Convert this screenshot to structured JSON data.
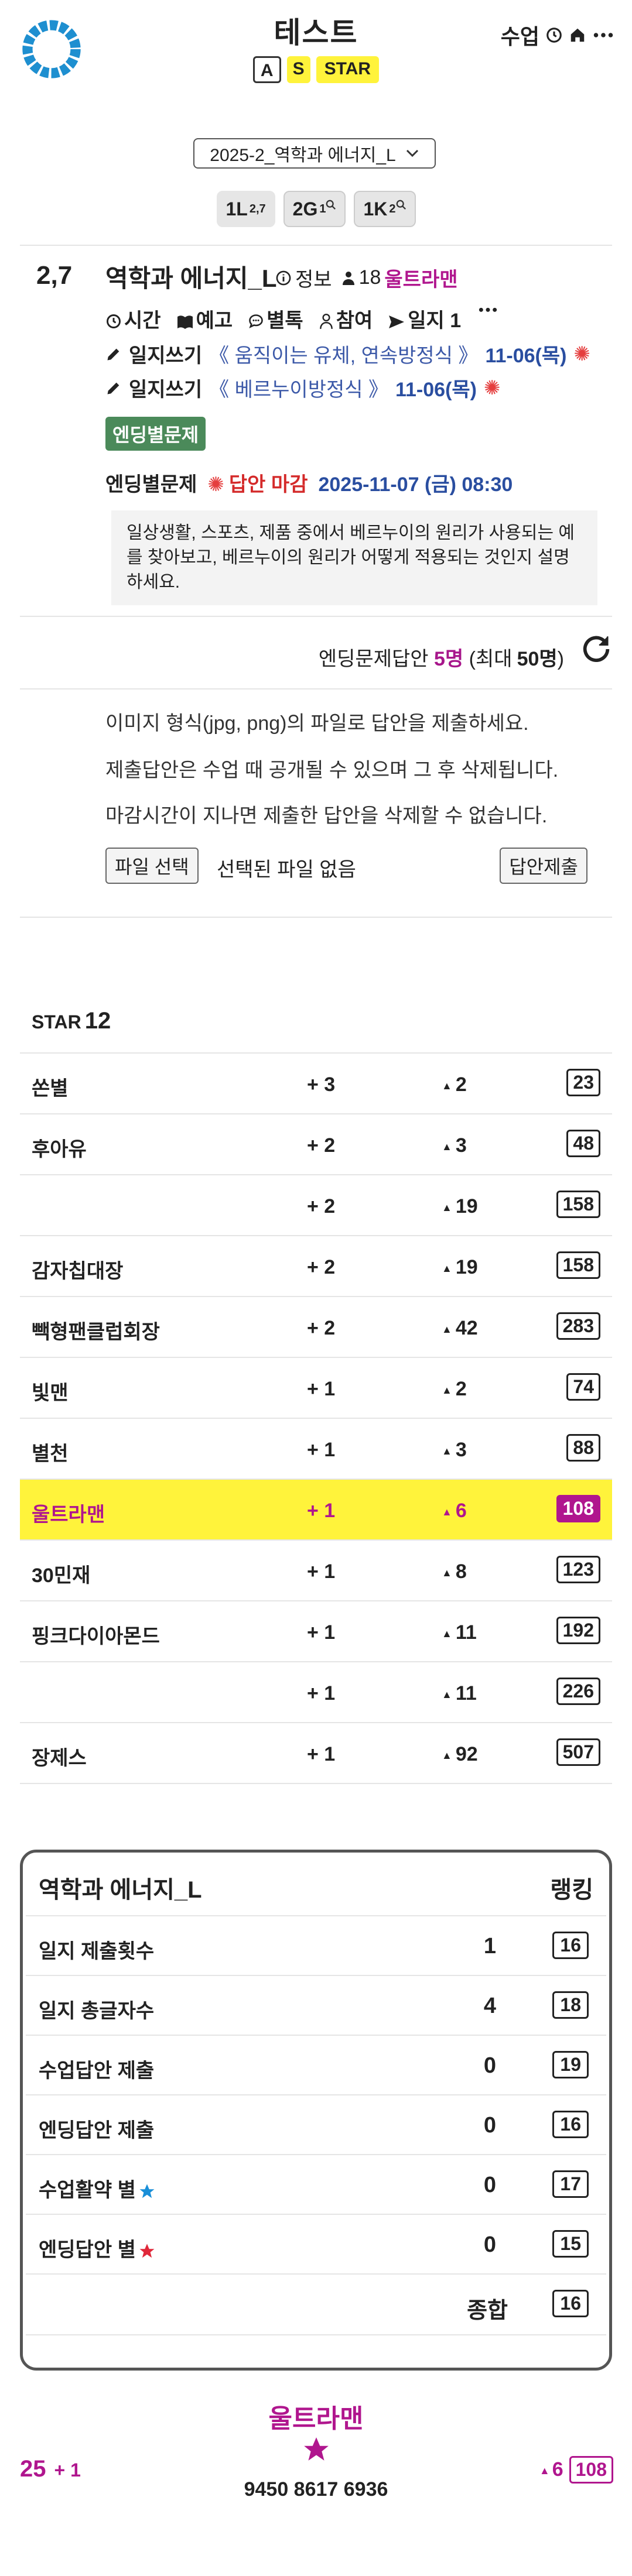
{
  "header": {
    "title": "테스트",
    "badges": [
      "A",
      "S",
      "STAR"
    ],
    "menu_label": "수업",
    "icons": [
      "clock-icon",
      "home-icon",
      "more-icon"
    ]
  },
  "selector": {
    "value": "2025-2_역학과 에너지_L"
  },
  "levels": [
    {
      "main": "1L",
      "sup": "2,7"
    },
    {
      "main": "2G",
      "sup": "1"
    },
    {
      "main": "1K",
      "sup": "2"
    }
  ],
  "course": {
    "score": "2,7",
    "name": "역학과 에너지_L",
    "info_label": "정보",
    "members": "18",
    "owner": "울트라맨",
    "actions": [
      "시간",
      "예고",
      "별톡",
      "참여",
      "일지 1"
    ],
    "logs": [
      {
        "label": "일지쓰기",
        "topic": "《 움직이는 유체, 연속방정식 》",
        "date": "11-06(목)"
      },
      {
        "label": "일지쓰기",
        "topic": "《 베르누이방정식 》",
        "date": "11-06(목)"
      }
    ],
    "tag": "엔딩별문제",
    "deadline_label": "엔딩별문제",
    "deadline_status": "답안 마감",
    "deadline_time": "2025-11-07 (금) 08:30",
    "question": "일상생활, 스포츠, 제품 중에서 베르누이의 원리가 사용되는 예를 찾아보고, 베르누이의 원리가 어떻게 적용되는 것인지 설명하세요."
  },
  "answers": {
    "label": "엔딩문제답안",
    "count": "5명",
    "max_prefix": "(최대",
    "max": "50명",
    "max_suffix": ")"
  },
  "notes": [
    "이미지 형식(jpg, png)의 파일로 답안을 제출하세요.",
    "제출답안은 수업 때 공개될 수 있으며 그 후 삭제됩니다.",
    "마감시간이 지나면 제출한 답안을 삭제할 수 없습니다."
  ],
  "upload": {
    "file_button": "파일 선택",
    "no_file": "선택된 파일 없음",
    "submit_button": "답안제출"
  },
  "ranking": {
    "label": "STAR",
    "count": "12",
    "rows": [
      {
        "name": "쏜별",
        "plus": "+ 3",
        "up": "2",
        "rank": "23"
      },
      {
        "name": "후아유",
        "plus": "+ 2",
        "up": "3",
        "rank": "48"
      },
      {
        "name": "",
        "plus": "+ 2",
        "up": "19",
        "rank": "158"
      },
      {
        "name": "감자칩대장",
        "plus": "+ 2",
        "up": "19",
        "rank": "158"
      },
      {
        "name": "빽형팬클럽회장",
        "plus": "+ 2",
        "up": "42",
        "rank": "283"
      },
      {
        "name": "빛맨",
        "plus": "+ 1",
        "up": "2",
        "rank": "74"
      },
      {
        "name": "별천",
        "plus": "+ 1",
        "up": "3",
        "rank": "88"
      },
      {
        "name": "울트라맨",
        "plus": "+ 1",
        "up": "6",
        "rank": "108",
        "me": true
      },
      {
        "name": "30민재",
        "plus": "+ 1",
        "up": "8",
        "rank": "123"
      },
      {
        "name": "핑크다이아몬드",
        "plus": "+ 1",
        "up": "11",
        "rank": "192"
      },
      {
        "name": "",
        "plus": "+ 1",
        "up": "11",
        "rank": "226"
      },
      {
        "name": "장제스",
        "plus": "+ 1",
        "up": "92",
        "rank": "507"
      }
    ]
  },
  "stats": {
    "title": "역학과 에너지_L",
    "rank_label": "랭킹",
    "rows": [
      {
        "label": "일지 제출횟수",
        "value": "1",
        "rank": "16"
      },
      {
        "label": "일지 총글자수",
        "value": "4",
        "rank": "18"
      },
      {
        "label": "수업답안 제출",
        "value": "0",
        "rank": "19"
      },
      {
        "label": "엔딩답안 제출",
        "value": "0",
        "rank": "16"
      },
      {
        "label": "수업활약 별",
        "value": "0",
        "rank": "17",
        "star": "#1a8fd8"
      },
      {
        "label": "엔딩답안 별",
        "value": "0",
        "rank": "15",
        "star": "#e0283a"
      },
      {
        "label": "",
        "value": "종합",
        "rank": "16"
      }
    ]
  },
  "footer": {
    "name": "울트라맨",
    "number": "9450 8617 6936",
    "left_value": "25",
    "left_delta": "+ 1",
    "up": "6",
    "rank": "108"
  },
  "colors": {
    "accent": "#b0168e",
    "highlight": "#fff33b",
    "tag": "#4b8a5a",
    "link": "#3c59a8"
  }
}
